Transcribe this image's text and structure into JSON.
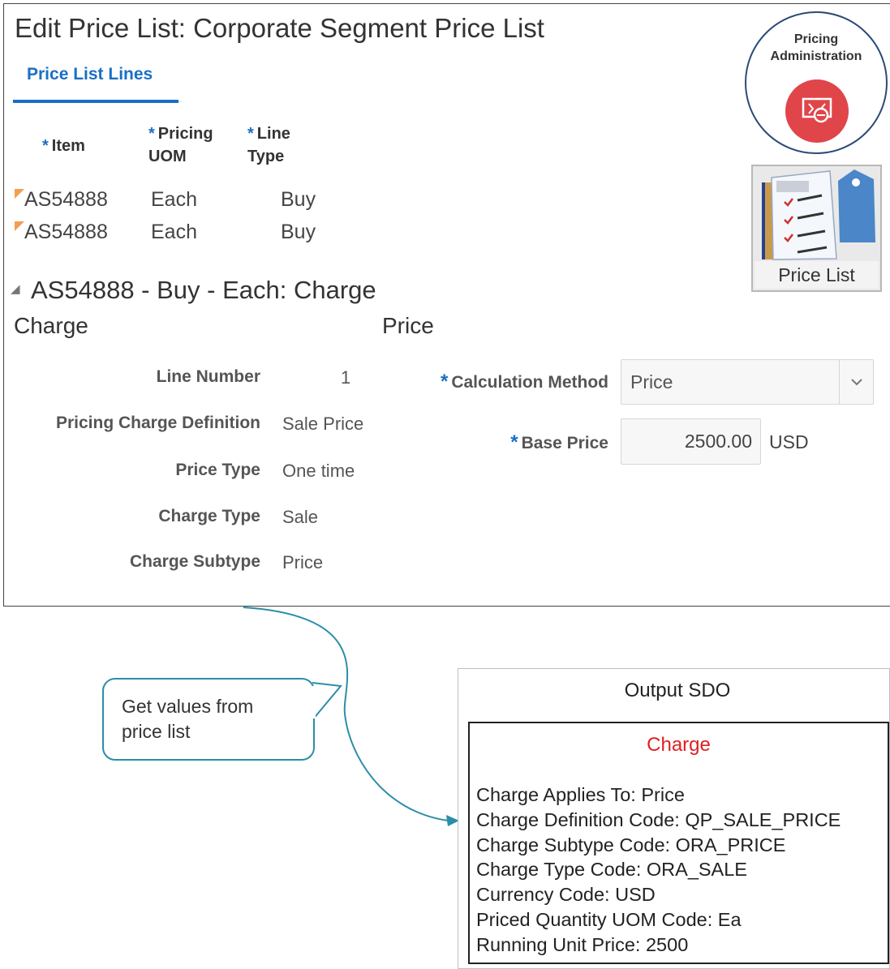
{
  "page": {
    "title": "Edit Price List:  Corporate Segment Price List",
    "tab_label": "Price List Lines"
  },
  "table": {
    "columns": [
      {
        "required": "*",
        "label": "Item"
      },
      {
        "required": "*",
        "label": "Pricing UOM"
      },
      {
        "required": "*",
        "label": "Line Type"
      }
    ],
    "rows": [
      {
        "item": "AS54888",
        "uom": "Each",
        "line_type": "Buy"
      },
      {
        "item": "AS54888",
        "uom": "Each",
        "line_type": "Buy"
      }
    ]
  },
  "detail": {
    "toggle": "◢",
    "heading": "AS54888 - Buy - Each: Charge",
    "charge_heading": "Charge",
    "price_heading": "Price",
    "charge_fields": [
      {
        "label": "Line Number",
        "value": "1"
      },
      {
        "label": "Pricing Charge Definition",
        "value": "Sale Price"
      },
      {
        "label": "Price Type",
        "value": "One time"
      },
      {
        "label": "Charge Type",
        "value": "Sale"
      },
      {
        "label": "Charge Subtype",
        "value": "Price"
      }
    ],
    "calc_method": {
      "required": "*",
      "label": "Calculation Method",
      "value": "Price"
    },
    "base_price": {
      "required": "*",
      "label": "Base Price",
      "value": "2500.00",
      "currency": "USD"
    }
  },
  "badge": {
    "line1": "Pricing",
    "line2": "Administration",
    "icon": "price-tag-icon"
  },
  "tile": {
    "label": "Price List",
    "icon": "price-list-icon"
  },
  "callout": {
    "line1": "Get values  from",
    "line2": "price list"
  },
  "sdo": {
    "title": "Output SDO",
    "subtitle": "Charge",
    "lines": [
      "Charge  Applies To: Price",
      "Charge  Definition Code: QP_SALE_PRICE",
      "Charge  Subtype Code: ORA_PRICE",
      "Charge  Type Code: ORA_SALE",
      "Currency  Code: USD",
      "Priced Quantity UOM Code: Ea",
      "Running  Unit Price: 2500"
    ]
  },
  "colors": {
    "accent": "#1a6fc4",
    "connector": "#2b8ea8",
    "badge_red": "#e0454a",
    "sdo_red": "#e02020"
  }
}
